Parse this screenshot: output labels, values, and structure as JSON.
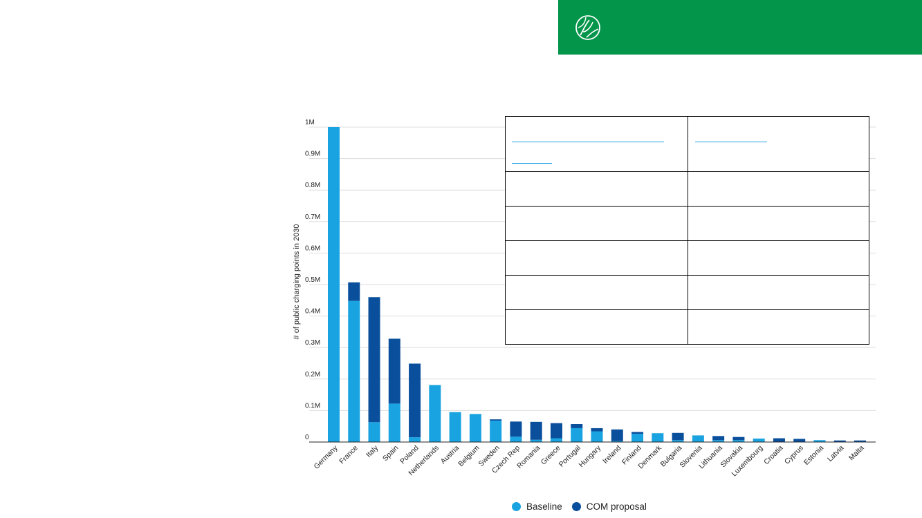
{
  "colors": {
    "banner": "#03954a",
    "baseline": "#19a3e0",
    "com_proposal": "#0a4f9c",
    "grid": "#dddddd",
    "axis": "#222222",
    "table_link": "#19a3e0"
  },
  "logo": {
    "icon": "leaf-globe-icon"
  },
  "legend": {
    "items": [
      {
        "label": "Baseline",
        "color": "#19a3e0"
      },
      {
        "label": "COM proposal",
        "color": "#0a4f9c"
      }
    ],
    "placement": "bottom"
  },
  "chart_data": {
    "type": "bar",
    "stacked": true,
    "title": "",
    "xlabel": "",
    "ylabel": "# of public charging points in 2030",
    "ylim": [
      0,
      1000000
    ],
    "yticks": [
      {
        "value": 0,
        "label": "0"
      },
      {
        "value": 100000,
        "label": "0.1M"
      },
      {
        "value": 200000,
        "label": "0.2M"
      },
      {
        "value": 300000,
        "label": "0.3M"
      },
      {
        "value": 400000,
        "label": "0.4M"
      },
      {
        "value": 500000,
        "label": "0.5M"
      },
      {
        "value": 600000,
        "label": "0.6M"
      },
      {
        "value": 700000,
        "label": "0.7M"
      },
      {
        "value": 800000,
        "label": "0.8M"
      },
      {
        "value": 900000,
        "label": "0.9M"
      },
      {
        "value": 1000000,
        "label": "1M"
      }
    ],
    "grid": true,
    "categories": [
      "Germany",
      "France",
      "Italy",
      "Spain",
      "Poland",
      "Netherlands",
      "Austria",
      "Belgium",
      "Sweden",
      "Czech Rep",
      "Romania",
      "Greece",
      "Portugal",
      "Hungary",
      "Ireland",
      "Finland",
      "Denmark",
      "Bulgaria",
      "Slovenia",
      "Lithuania",
      "Slovakia",
      "Luxembourg",
      "Croatia",
      "Cyprus",
      "Estonia",
      "Latvia",
      "Malta"
    ],
    "series": [
      {
        "name": "Baseline",
        "values": [
          1000000,
          448000,
          63000,
          122000,
          15000,
          181000,
          95000,
          89000,
          68000,
          17000,
          7000,
          12000,
          44000,
          34000,
          3000,
          26000,
          28000,
          6000,
          21000,
          6000,
          6000,
          11000,
          1000,
          1000,
          6000,
          1000,
          1000
        ]
      },
      {
        "name": "COM proposal",
        "values": [
          0,
          59000,
          397000,
          206000,
          234000,
          0,
          0,
          0,
          4000,
          48000,
          57000,
          48000,
          13000,
          10000,
          37000,
          6000,
          0,
          23000,
          0,
          13000,
          10000,
          0,
          11000,
          9000,
          0,
          4000,
          4000
        ]
      }
    ]
  }
}
